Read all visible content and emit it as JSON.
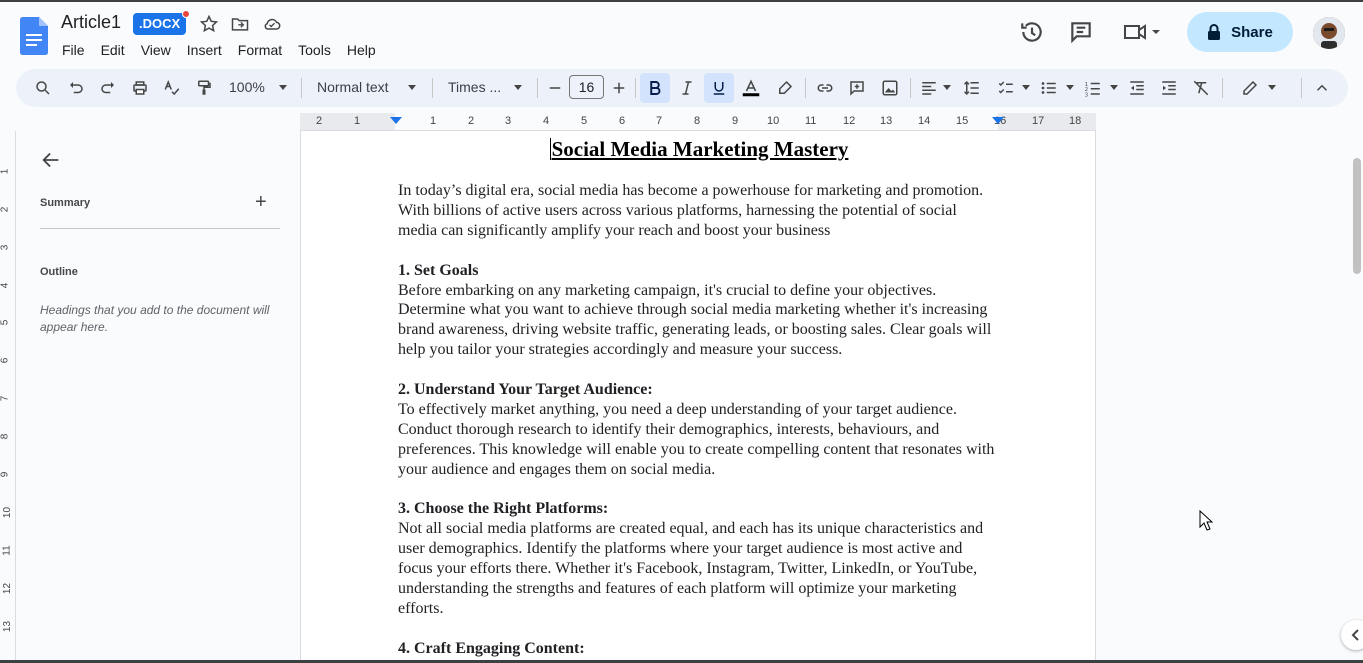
{
  "app": {
    "title": "Article1",
    "badge": ".DOCX"
  },
  "menu": [
    "File",
    "Edit",
    "View",
    "Insert",
    "Format",
    "Tools",
    "Help"
  ],
  "share": {
    "label": "Share"
  },
  "toolbar": {
    "zoom": "100%",
    "style": "Normal text",
    "font": "Times ...",
    "font_size": "16"
  },
  "panel": {
    "summary_label": "Summary",
    "outline_label": "Outline",
    "outline_hint": "Headings that you add to the document will appear here."
  },
  "ruler": {
    "ticks": [
      "2",
      "1",
      "1",
      "2",
      "3",
      "4",
      "5",
      "6",
      "7",
      "8",
      "9",
      "10",
      "11",
      "12",
      "13",
      "14",
      "15",
      "16",
      "17",
      "18"
    ],
    "vticks": [
      "1",
      "2",
      "3",
      "4",
      "5",
      "6",
      "7",
      "8",
      "9",
      "10",
      "11",
      "12",
      "13"
    ]
  },
  "document": {
    "title": "Social Media Marketing Mastery",
    "intro": "In today’s digital era, social media has become a powerhouse for marketing and promotion. With billions of active users across various platforms, harnessing the potential of social media can significantly amplify your reach and boost your business",
    "sections": [
      {
        "heading": "1. Set Goals",
        "text": "Before embarking on any marketing campaign, it's crucial to define your objectives. Determine what you want to achieve through social media marketing whether it's increasing brand awareness, driving website traffic, generating leads, or boosting sales. Clear goals will help you tailor your strategies accordingly and measure your success."
      },
      {
        "heading": "2. Understand Your Target Audience:",
        "text": "To effectively market anything, you need a deep understanding of your target audience. Conduct thorough research to identify their demographics, interests, behaviours, and preferences. This knowledge will enable you to create compelling content that resonates with your audience and engages them on social media."
      },
      {
        "heading": "3. Choose the Right Platforms:",
        "text": "Not all social media platforms are created equal, and each has its unique characteristics and user demographics. Identify the platforms where your target audience is most active and focus your efforts there. Whether it's Facebook, Instagram, Twitter, LinkedIn, or YouTube, understanding the strengths and features of each platform will optimize your marketing efforts."
      },
      {
        "heading": "4. Craft Engaging Content:",
        "text": ""
      }
    ]
  },
  "colors": {
    "brand_blue": "#1a73e8",
    "share_bg": "#c2e7ff",
    "toolbar_bg": "#edf2fa",
    "active_btn": "#d3e3fd"
  }
}
